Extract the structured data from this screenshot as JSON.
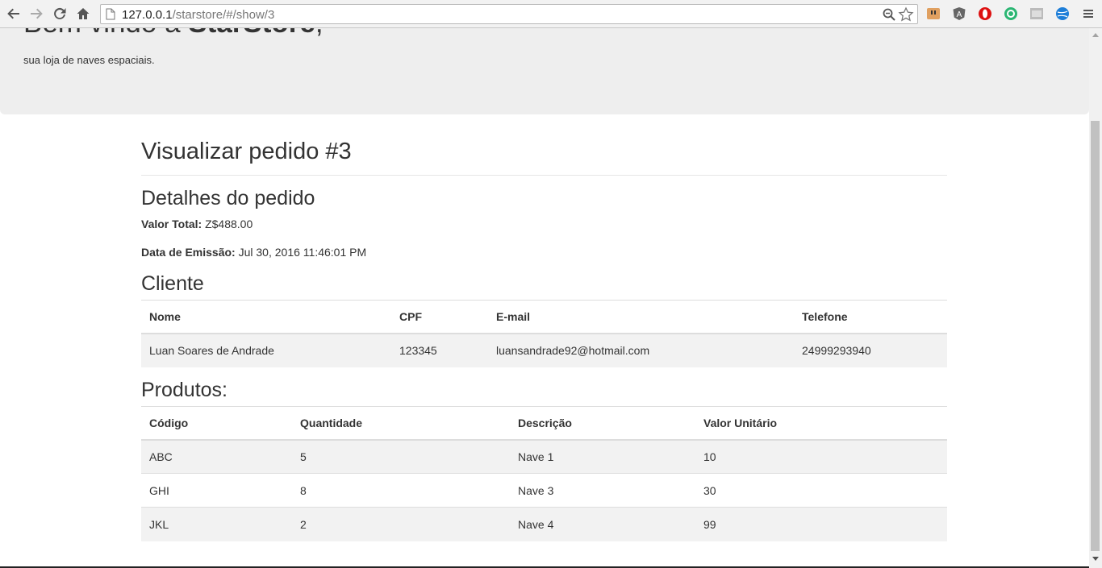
{
  "browser": {
    "url_host": "127.0.0.1",
    "url_path": "/starstore/#/show/3"
  },
  "jumbotron": {
    "heading_prefix": "Bem vindo à ",
    "heading_brand": "StarStore",
    "heading_suffix": ",",
    "tagline": "sua loja de naves espaciais."
  },
  "page": {
    "title": "Visualizar pedido #3"
  },
  "details": {
    "heading": "Detalhes do pedido",
    "total_label": "Valor Total:",
    "total_value": "Z$488.00",
    "date_label": "Data de Emissão:",
    "date_value": "Jul 30, 2016 11:46:01 PM"
  },
  "client": {
    "heading": "Cliente",
    "columns": [
      "Nome",
      "CPF",
      "E-mail",
      "Telefone"
    ],
    "row": {
      "nome": "Luan Soares de Andrade",
      "cpf": "123345",
      "email": "luansandrade92@hotmail.com",
      "telefone": "24999293940"
    }
  },
  "products": {
    "heading": "Produtos:",
    "columns": [
      "Código",
      "Quantidade",
      "Descrição",
      "Valor Unitário"
    ],
    "rows": [
      {
        "codigo": "ABC",
        "quantidade": "5",
        "descricao": "Nave 1",
        "valor": "10"
      },
      {
        "codigo": "GHI",
        "quantidade": "8",
        "descricao": "Nave 3",
        "valor": "30"
      },
      {
        "codigo": "JKL",
        "quantidade": "2",
        "descricao": "Nave 4",
        "valor": "99"
      }
    ]
  },
  "colors": {
    "jumbotron_bg": "#eeeeee",
    "text": "#333333",
    "stripe": "#f2f2f2"
  }
}
